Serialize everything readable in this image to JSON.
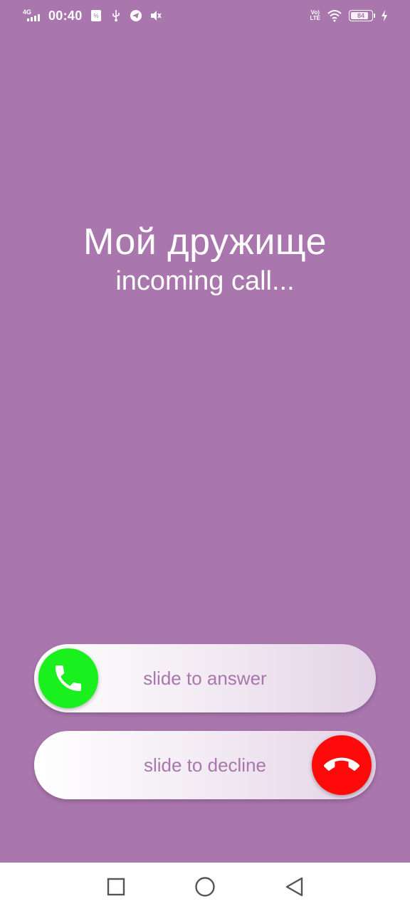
{
  "status_bar": {
    "network_type": "4G",
    "time": "00:40",
    "volte_label_top": "Vo)",
    "volte_label_bottom": "LTE",
    "battery_level": "84",
    "icons": [
      "signal-icon",
      "sim-card-icon",
      "usb-icon",
      "telegram-icon",
      "mute-icon",
      "volte-icon",
      "wifi-icon",
      "battery-icon",
      "charging-icon"
    ]
  },
  "caller": {
    "name": "Мой дружище",
    "status": "incoming call..."
  },
  "answer_slider": {
    "label": "slide to answer",
    "knob_color": "#19f01d",
    "icon": "phone-icon"
  },
  "decline_slider": {
    "label": "slide to decline",
    "knob_color": "#ff0a0a",
    "icon": "hang-up-icon"
  },
  "nav_bar": {
    "buttons": [
      "recent-apps",
      "home",
      "back"
    ]
  },
  "colors": {
    "background": "#a976ad",
    "accent_text": "#a976ad"
  }
}
